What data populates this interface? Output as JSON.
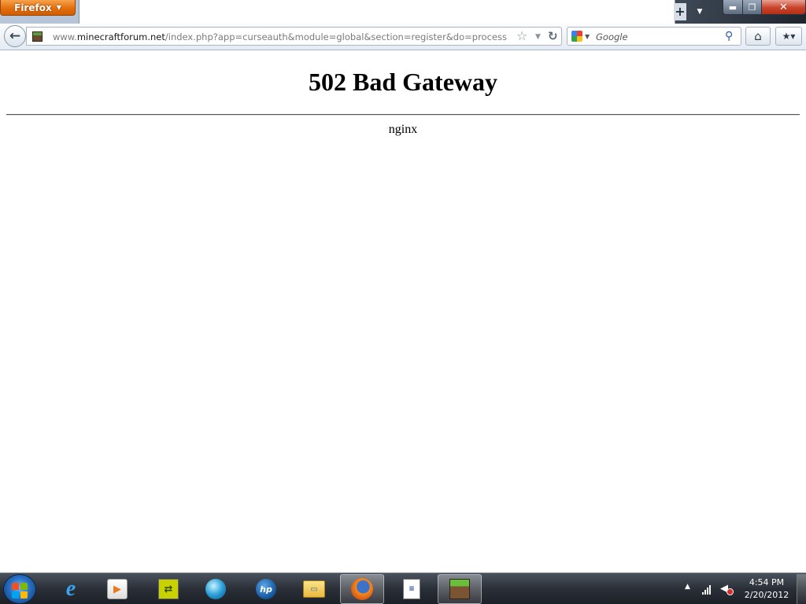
{
  "browser": {
    "app_button_label": "Firefox",
    "new_tab_glyph": "+",
    "window_controls": {
      "minimize": "▬",
      "maximize": "❐",
      "close": "✕"
    }
  },
  "navbar": {
    "back_glyph": "←",
    "url_prefix": "www.",
    "url_domain": "minecraftforum.net",
    "url_path": "/index.php?app=curseauth&module=global&section=register&do=process",
    "search_placeholder": "Google",
    "icons": {
      "favicon": "minecraft-grass-block-icon",
      "bookmark": "star-icon",
      "reload": "reload-icon",
      "search_engine": "google-icon",
      "search_go": "magnifier-icon",
      "home": "home-icon",
      "bookmarks": "bookmarks-star-icon"
    }
  },
  "page": {
    "title": "502 Bad Gateway",
    "server": "nginx"
  },
  "taskbar": {
    "pinned": [
      {
        "name": "Internet Explorer",
        "icon": "ie-icon"
      },
      {
        "name": "Media Player",
        "icon": "media-icon"
      },
      {
        "name": "Sync",
        "icon": "sync-icon"
      },
      {
        "name": "Globe app",
        "icon": "globe-icon"
      },
      {
        "name": "HP",
        "icon": "hp-icon"
      },
      {
        "name": "Windows Explorer",
        "icon": "folder-icon"
      },
      {
        "name": "Firefox",
        "icon": "firefox-icon",
        "active": true
      },
      {
        "name": "Notepad",
        "icon": "notepad-icon"
      },
      {
        "name": "Minecraft",
        "icon": "minecraft-icon",
        "active": true
      }
    ],
    "clock_time": "4:54 PM",
    "clock_date": "2/20/2012",
    "colors": {
      "accent": "#e36f0d",
      "start": "#2670c6",
      "mute": "#d62b2b"
    }
  }
}
